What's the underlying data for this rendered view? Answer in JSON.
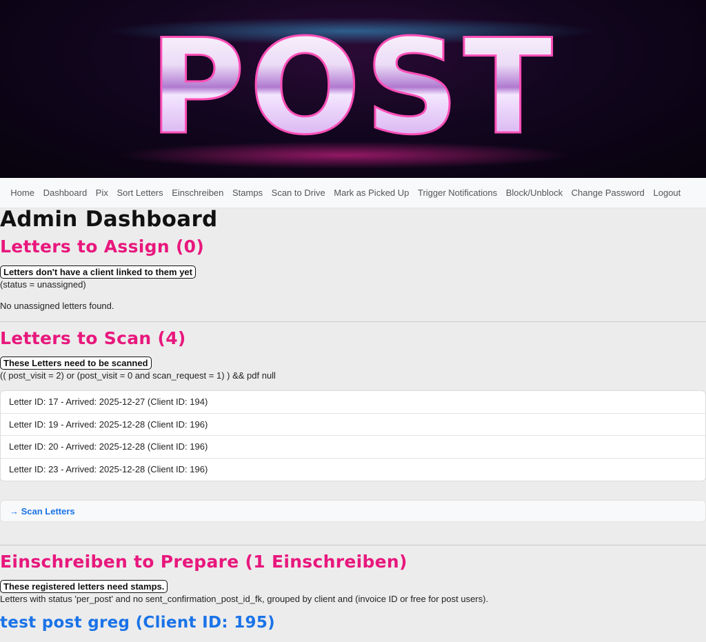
{
  "banner": {
    "logo_text": "POST"
  },
  "nav": {
    "items": [
      {
        "label": "Home"
      },
      {
        "label": "Dashboard"
      },
      {
        "label": "Pix"
      },
      {
        "label": "Sort Letters"
      },
      {
        "label": "Einschreiben"
      },
      {
        "label": "Stamps"
      },
      {
        "label": "Scan to Drive"
      },
      {
        "label": "Mark as Picked Up"
      },
      {
        "label": "Trigger Notifications"
      },
      {
        "label": "Block/Unblock"
      },
      {
        "label": "Change Password"
      },
      {
        "label": "Logout"
      }
    ]
  },
  "page": {
    "title": "Admin Dashboard"
  },
  "assign": {
    "heading": "Letters to Assign (0)",
    "badge": "Letters don't have a client linked to them yet",
    "criteria": "(status = unassigned)",
    "empty": "No unassigned letters found."
  },
  "scan": {
    "heading": "Letters to Scan (4)",
    "badge": "These Letters need to be scanned",
    "criteria": "(( post_visit = 2) or (post_visit = 0 and scan_request = 1) ) && pdf null",
    "letters": [
      {
        "text": "Letter ID: 17 - Arrived: 2025-12-27 (Client ID: 194)"
      },
      {
        "text": "Letter ID: 19 - Arrived: 2025-12-28 (Client ID: 196)"
      },
      {
        "text": "Letter ID: 20 - Arrived: 2025-12-28 (Client ID: 196)"
      },
      {
        "text": "Letter ID: 23 - Arrived: 2025-12-28 (Client ID: 196)"
      }
    ],
    "action_label": "→ Scan Letters"
  },
  "einschreiben": {
    "heading": "Einschreiben to Prepare (1 Einschreiben)",
    "badge": "These registered letters need stamps.",
    "criteria": "Letters with status 'per_post' and no sent_confirmation_post_id_fk, grouped by client and (invoice ID or free for post users).",
    "client_heading": "test post greg (Client ID: 195)"
  },
  "colors": {
    "accent_pink": "#e8177d",
    "link_blue": "#1a73e8"
  }
}
